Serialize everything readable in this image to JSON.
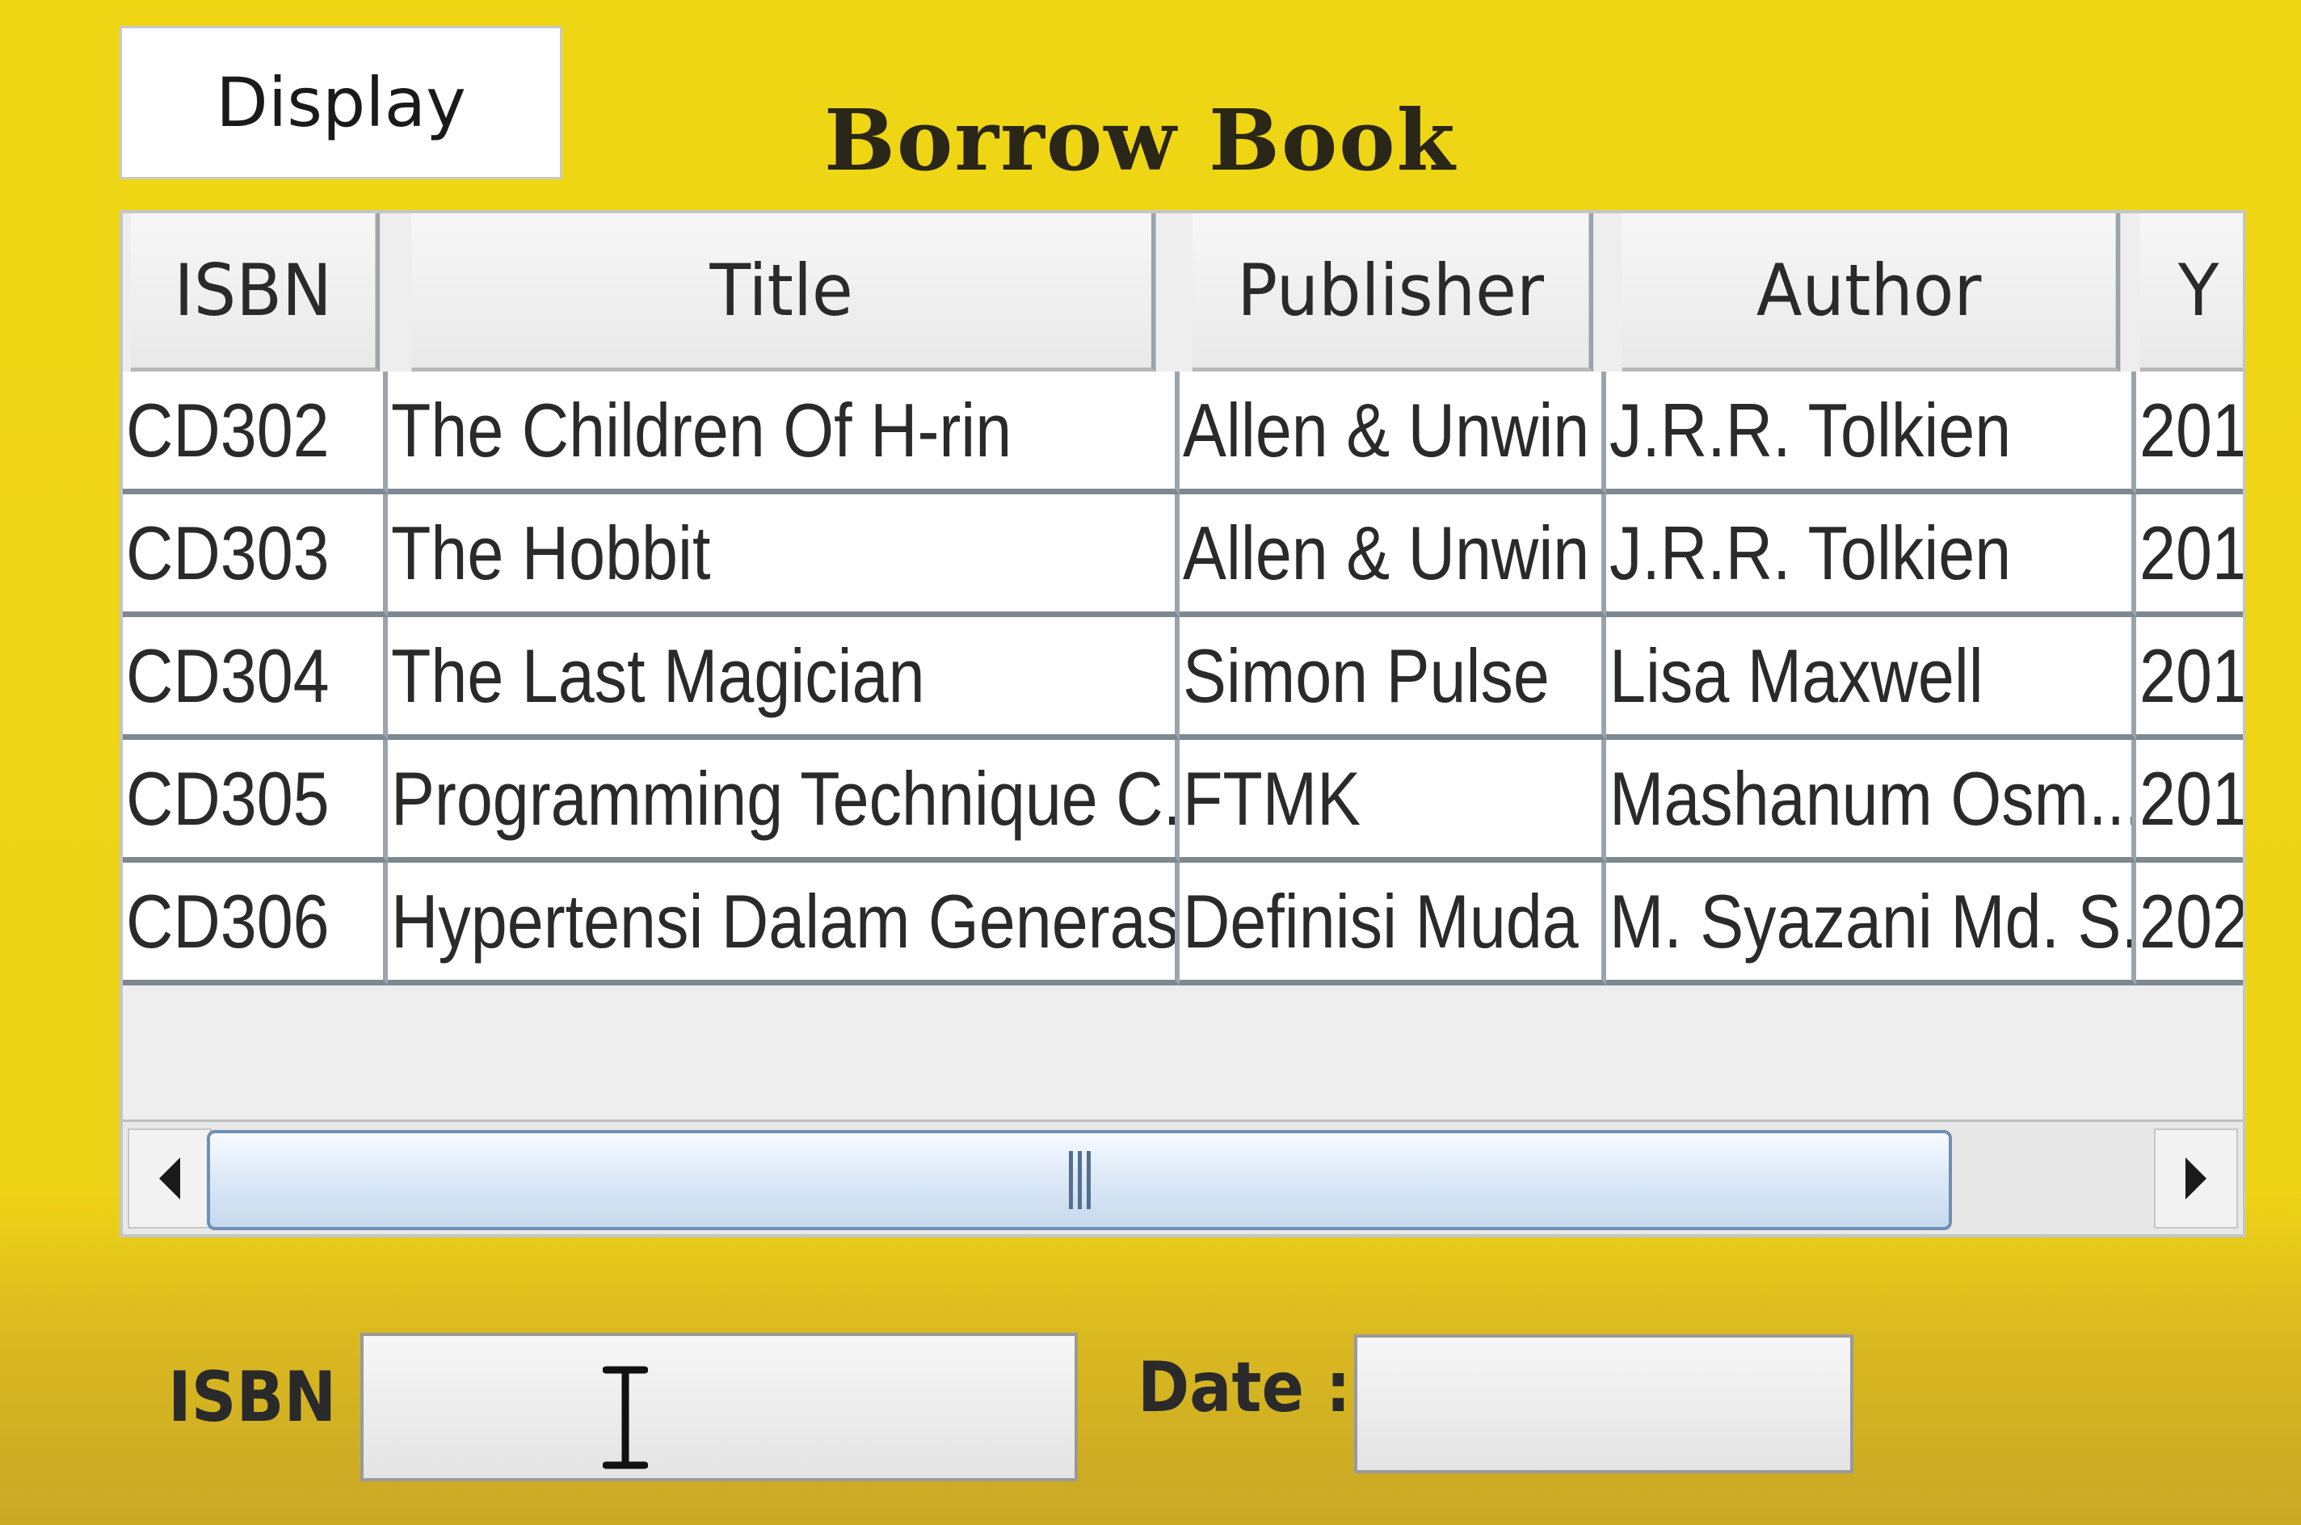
{
  "toolbar": {
    "display_label": "Display"
  },
  "page": {
    "title": "Borrow Book"
  },
  "table": {
    "columns": [
      "ISBN",
      "Title",
      "Publisher",
      "Author",
      "Y"
    ],
    "rows": [
      [
        "CD302",
        "The Children Of H-rin",
        "Allen & Unwin",
        "J.R.R. Tolkien",
        "201"
      ],
      [
        "CD303",
        "The Hobbit",
        "Allen & Unwin",
        "J.R.R. Tolkien",
        "201"
      ],
      [
        "CD304",
        "The Last Magician",
        "Simon Pulse",
        "Lisa Maxwell",
        "201"
      ],
      [
        "CD305",
        "Programming Technique C...",
        "FTMK",
        "Mashanum Osm...",
        "201"
      ],
      [
        "CD306",
        "Hypertensi Dalam Generasi",
        "Definisi Muda",
        "M. Syazani Md. S...",
        "202"
      ]
    ]
  },
  "form": {
    "isbn_label": "ISBN :",
    "isbn_value": "",
    "date_label": "Date :",
    "date_value": ""
  },
  "colors": {
    "background": "#efd615",
    "title": "#2a2618",
    "scroll_thumb": "#dbe8f6",
    "grid_line": "#7e8890"
  },
  "icons": {
    "scroll_left": "triangle-left-icon",
    "scroll_right": "triangle-right-icon",
    "thumb_grip": "grip-icon",
    "cursor": "text-cursor-icon"
  }
}
